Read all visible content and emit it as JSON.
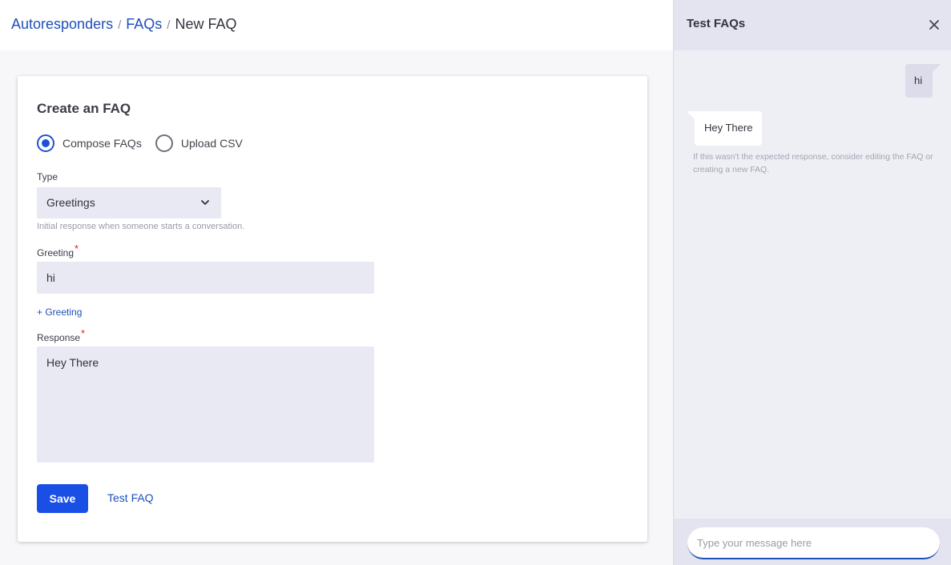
{
  "breadcrumb": {
    "items": [
      "Autoresponders",
      "FAQs"
    ],
    "current": "New FAQ",
    "separator": "/"
  },
  "form": {
    "title": "Create an FAQ",
    "mode_options": [
      {
        "label": "Compose FAQs",
        "selected": true
      },
      {
        "label": "Upload CSV",
        "selected": false
      }
    ],
    "type": {
      "label": "Type",
      "value": "Greetings",
      "help": "Initial response when someone starts a conversation."
    },
    "greeting": {
      "label": "Greeting",
      "required_mark": "*",
      "value": "hi",
      "add_label": "+ Greeting"
    },
    "response": {
      "label": "Response",
      "required_mark": "*",
      "value": "Hey There"
    },
    "save_label": "Save",
    "test_label": "Test FAQ"
  },
  "test_panel": {
    "title": "Test FAQs",
    "close_icon": "close-icon",
    "messages": [
      {
        "direction": "outgoing",
        "text": "hi"
      },
      {
        "direction": "incoming",
        "text": "Hey There"
      }
    ],
    "note": "If this wasn't the expected response, consider editing the FAQ or creating a new FAQ.",
    "composer_placeholder": "Type your message here"
  },
  "colors": {
    "accent": "#1a4fe6",
    "link": "#1e50b8",
    "field_bg": "#e9e9f4",
    "required": "#e0232e"
  }
}
